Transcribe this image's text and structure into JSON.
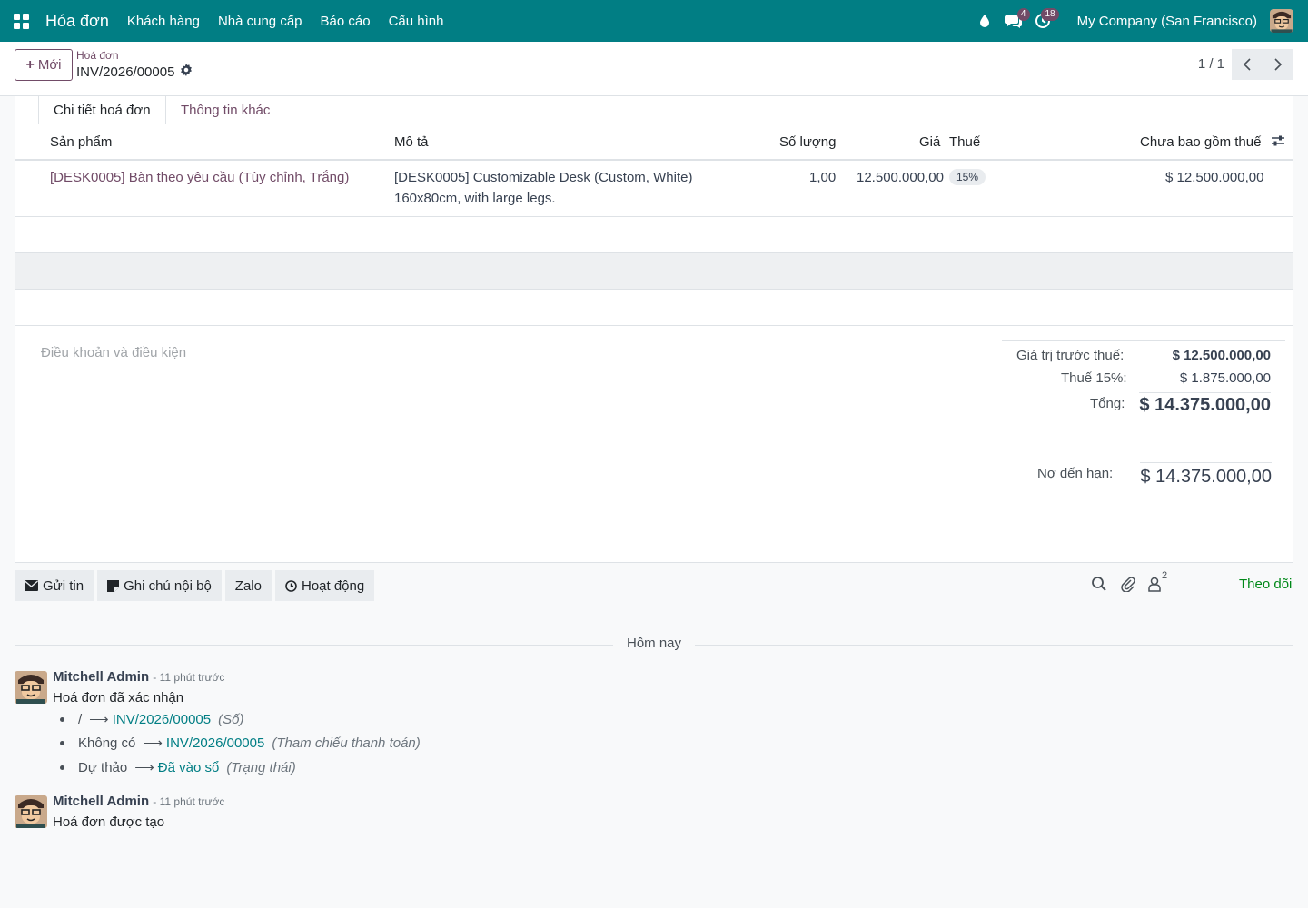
{
  "navbar": {
    "app_name": "Hóa đơn",
    "menu": [
      "Khách hàng",
      "Nhà cung cấp",
      "Báo cáo",
      "Cấu hình"
    ],
    "chat_count": "4",
    "activity_count": "18",
    "company": "My Company (San Francisco)"
  },
  "control": {
    "new_label": "Mới",
    "breadcrumb": "Hoá đơn",
    "record_name": "INV/2026/00005",
    "pager": "1 / 1"
  },
  "tabs": [
    "Chi tiết hoá đơn",
    "Thông tin khác"
  ],
  "table": {
    "headers": {
      "product": "Sản phẩm",
      "description": "Mô tả",
      "quantity": "Số lượng",
      "price": "Giá",
      "tax": "Thuế",
      "subtotal": "Chưa bao gồm thuế"
    },
    "rows": [
      {
        "product": "[DESK0005] Bàn theo yêu cầu (Tùy chỉnh, Trắng)",
        "description_line1": "[DESK0005] Customizable Desk (Custom, White)",
        "description_line2": "160x80cm, with large legs.",
        "quantity": "1,00",
        "price": "12.500.000,00",
        "tax": "15%",
        "subtotal": "$ 12.500.000,00"
      }
    ]
  },
  "notes_placeholder": "Điều khoản và điều kiện",
  "totals": {
    "untaxed_label": "Giá trị trước thuế:",
    "untaxed_value": "$ 12.500.000,00",
    "tax_label": "Thuế 15%:",
    "tax_value": "$ 1.875.000,00",
    "total_label": "Tổng:",
    "total_value": "$ 14.375.000,00",
    "due_label": "Nợ đến hạn:",
    "due_value": "$ 14.375.000,00"
  },
  "chatter": {
    "buttons": {
      "send": "Gửi tin",
      "note": "Ghi chú nội bộ",
      "zalo": "Zalo",
      "activity": "Hoạt động"
    },
    "followers_count": "2",
    "follow_label": "Theo dõi",
    "day_label": "Hôm nay",
    "messages": [
      {
        "author": "Mitchell Admin",
        "time": "- 11 phút trước",
        "body": "Hoá đơn đã xác nhận",
        "tracking": [
          {
            "old": "/",
            "new": "INV/2026/00005",
            "field": "(Số)"
          },
          {
            "old": "Không có",
            "new": "INV/2026/00005",
            "field": "(Tham chiếu thanh toán)"
          },
          {
            "old": "Dự thảo",
            "new": "Đã vào sổ",
            "field": "(Trạng thái)"
          }
        ]
      },
      {
        "author": "Mitchell Admin",
        "time": "- 11 phút trước",
        "body": "Hoá đơn được tạo"
      }
    ]
  },
  "colors": {
    "navbar": "#017e84",
    "brand": "#714b67",
    "follow": "#008818",
    "link": "#017e84"
  }
}
